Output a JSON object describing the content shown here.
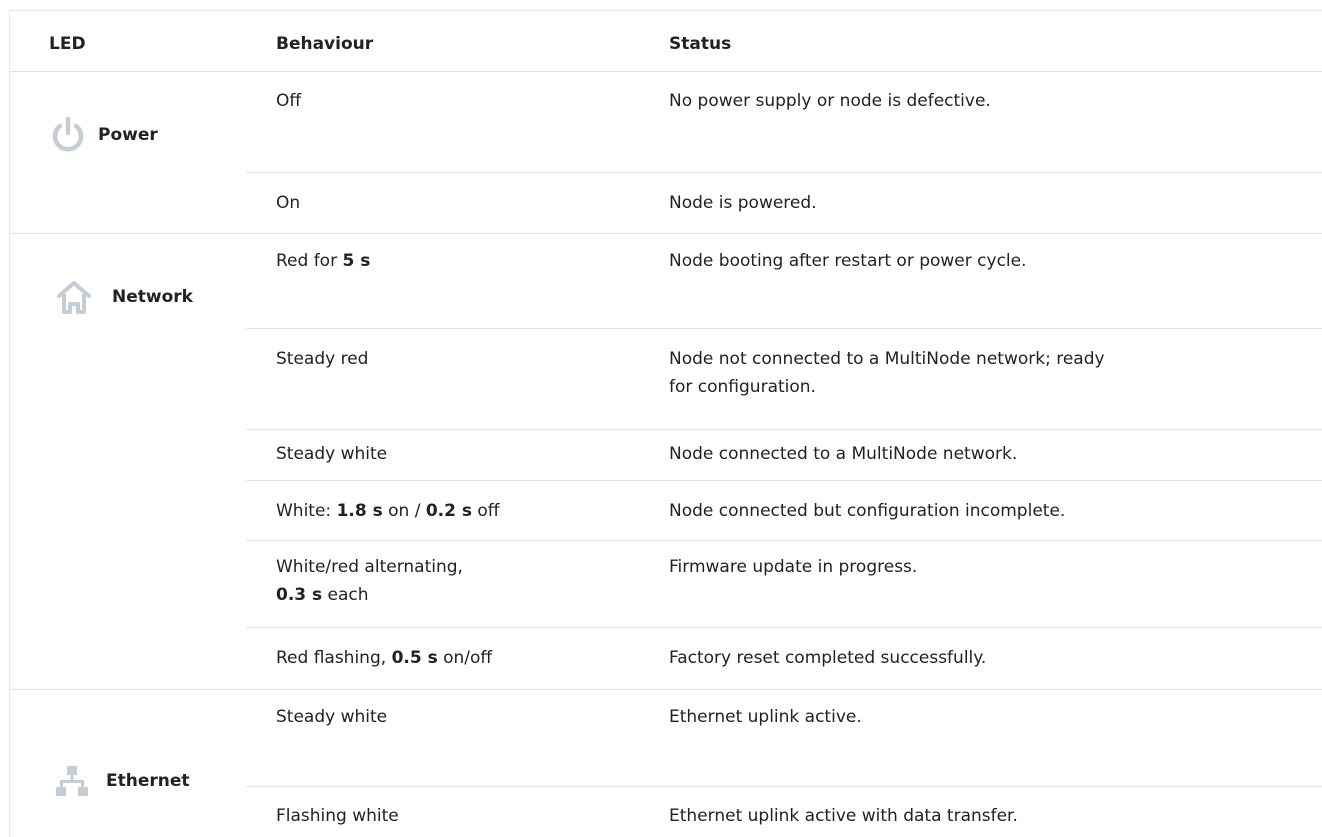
{
  "header": {
    "led": "LED",
    "behaviour": "Behaviour",
    "status": "Status"
  },
  "groups": [
    {
      "name": "Power",
      "icon": "power-icon"
    },
    {
      "name": "Network",
      "icon": "network-home-icon"
    },
    {
      "name": "Ethernet",
      "icon": "ethernet-icon"
    }
  ],
  "rows": [
    {
      "behaviour": [
        "Off"
      ],
      "status": [
        "No power supply or node is defective."
      ]
    },
    {
      "behaviour": [
        "On"
      ],
      "status": [
        "Node is powered."
      ]
    },
    {
      "behaviour_pre": "Red for ",
      "behaviour_bold": "5 s",
      "behaviour_post": "",
      "status": [
        "Node booting after restart or power cycle."
      ]
    },
    {
      "behaviour": [
        "Steady red"
      ],
      "status": [
        "Node not connected to a MultiNode network; ready",
        "for configuration."
      ]
    },
    {
      "behaviour": [
        "Steady white"
      ],
      "status": [
        "Node connected to a MultiNode network."
      ]
    },
    {
      "w1": "White: ",
      "w2": "1.8 s",
      "w3": " on / ",
      "w4": "0.2 s",
      "w5": " off",
      "status": [
        "Node connected but configuration incomplete."
      ]
    },
    {
      "a1": "White/red alternating,",
      "a2": "0.3 s",
      "a3": " each",
      "status": [
        "Firmware update in progress."
      ]
    },
    {
      "r1": "Red flashing, ",
      "r2": "0.5 s",
      "r3": " on/off",
      "status": [
        "Factory reset completed successfully."
      ]
    },
    {
      "behaviour": [
        "Steady white"
      ],
      "status": [
        "Ethernet uplink active."
      ]
    },
    {
      "behaviour": [
        "Flashing white"
      ],
      "status": [
        "Ethernet uplink active with data transfer."
      ]
    }
  ],
  "icon_color": "#c3cdd3"
}
